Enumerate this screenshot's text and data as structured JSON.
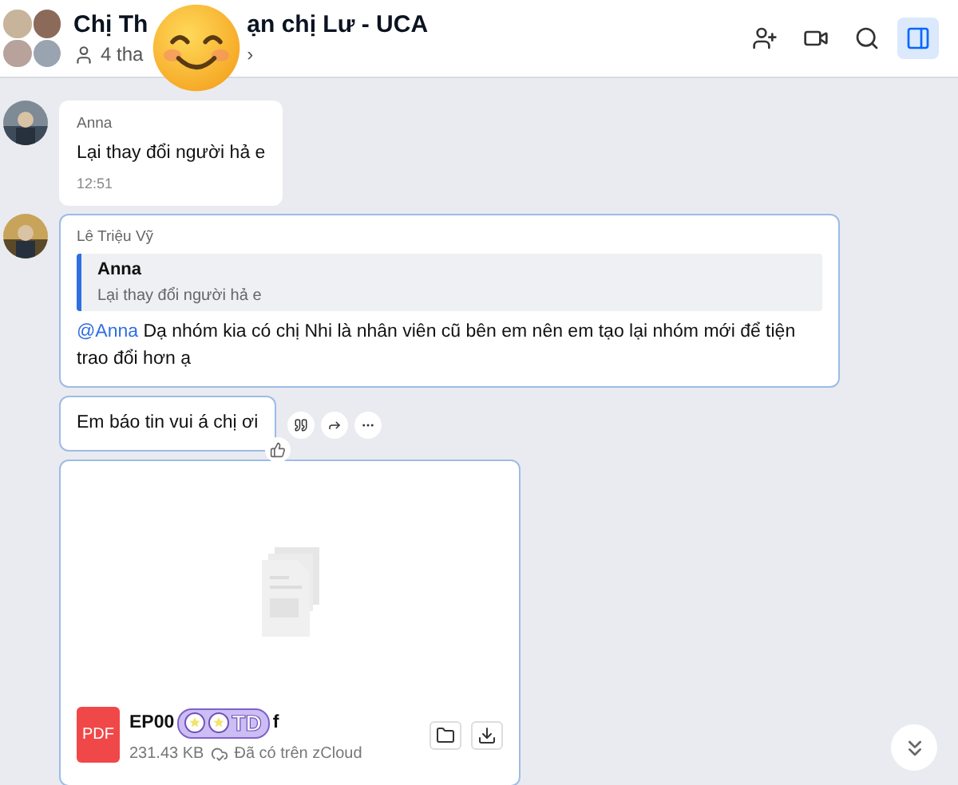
{
  "header": {
    "title_parts": [
      "Chị Th",
      "ạn chị Lư - UCA"
    ],
    "members_parts": [
      "4 tha",
      "›"
    ],
    "actions": [
      {
        "kind": "add-member",
        "selected": false
      },
      {
        "kind": "video",
        "selected": false
      },
      {
        "kind": "search",
        "selected": false
      },
      {
        "kind": "panel",
        "selected": true
      }
    ]
  },
  "messages": [
    {
      "kind": "text",
      "avatar": true,
      "sender": "Anna",
      "text": "Lại thay đổi người hả e",
      "time": "12:51",
      "highlighted": false
    },
    {
      "kind": "reply",
      "avatar": true,
      "sender": "Lê Triệu Vỹ",
      "quote": {
        "sender": "Anna",
        "text": "Lại thay đổi người hả e"
      },
      "mention": "@Anna",
      "text": "Dạ nhóm kia có chị Nhi là nhân viên cũ bên em nên em tạo lại nhóm mới để tiện trao đổi hơn ạ",
      "highlighted": true
    },
    {
      "kind": "text",
      "avatar": false,
      "text": "Em báo tin vui á chị ơi",
      "highlighted": true,
      "hover_actions": true
    },
    {
      "kind": "file",
      "avatar": false,
      "name_parts": [
        "EP00",
        "f"
      ],
      "type": "PDF",
      "size": "231.43 KB",
      "cloud": "Đã có trên zCloud",
      "highlighted": true
    }
  ],
  "sticker": {
    "text": "TD"
  }
}
